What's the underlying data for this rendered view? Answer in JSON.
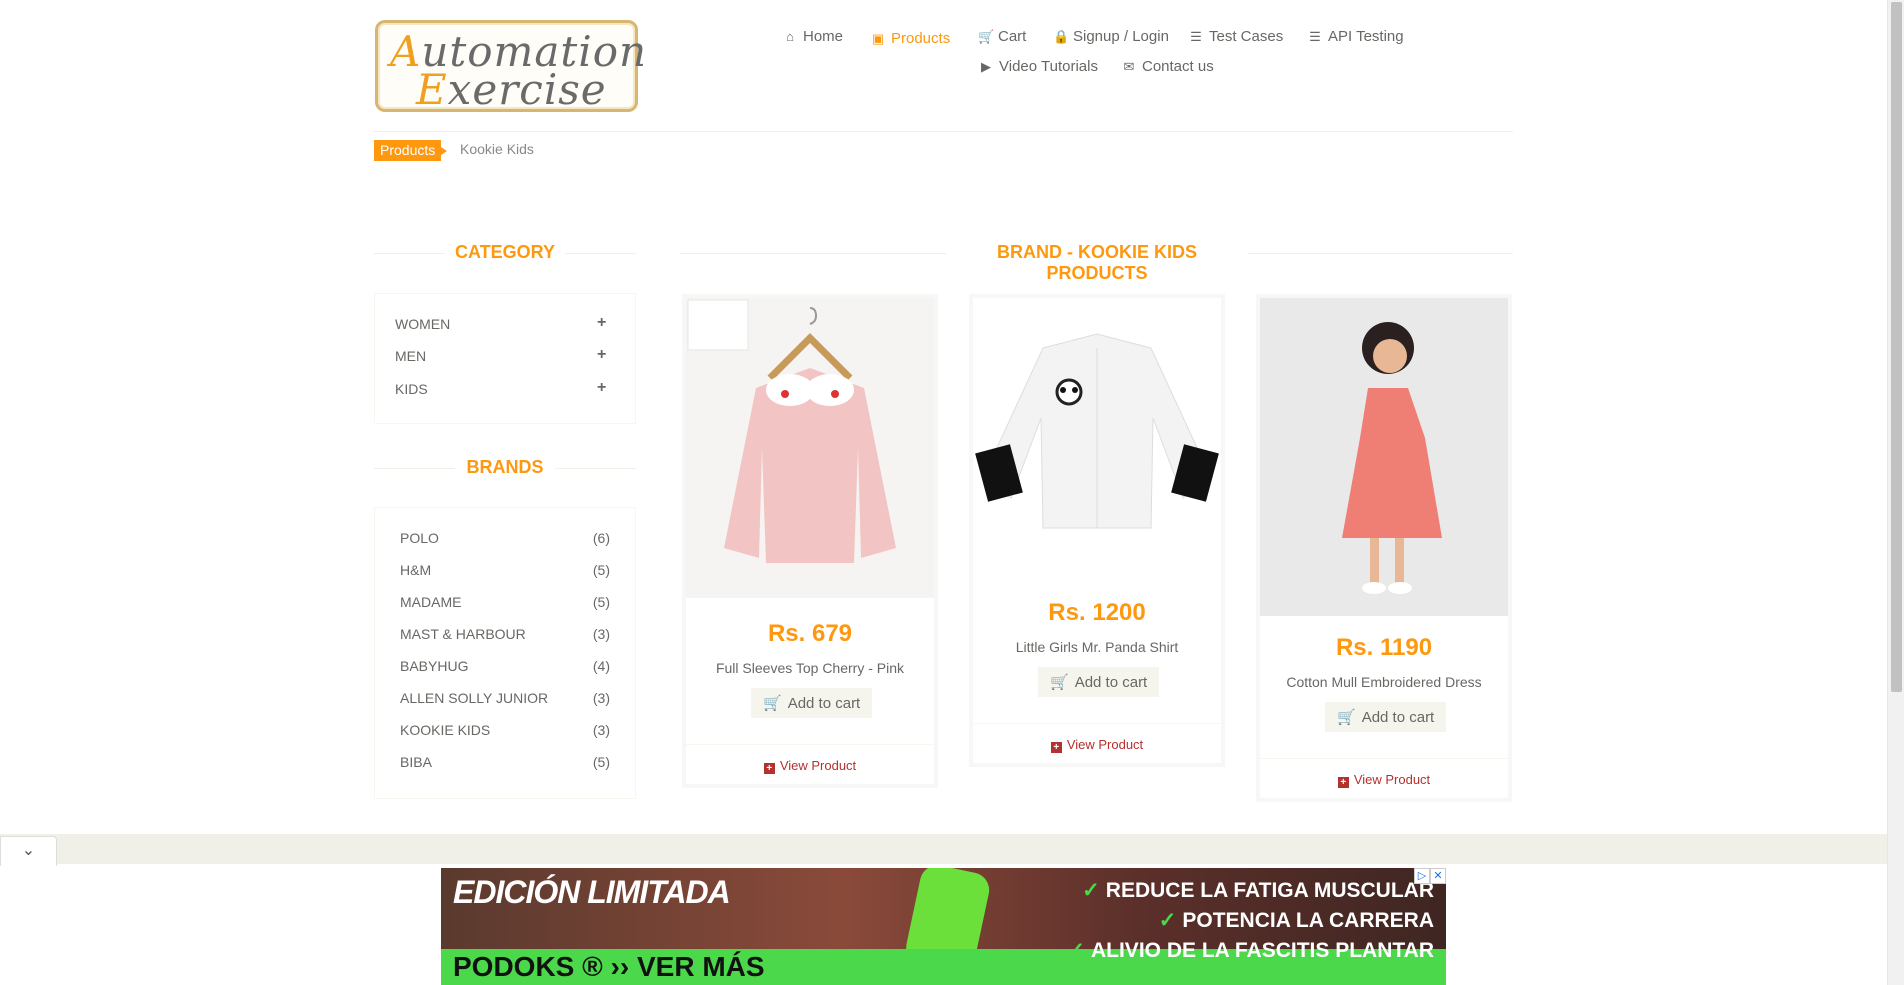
{
  "logo": {
    "line1": "utomation",
    "line1_cap": "A",
    "line2": "xercise",
    "line2_cap": "E"
  },
  "nav": [
    {
      "label": "Home",
      "icon": "home-icon"
    },
    {
      "label": "Products",
      "icon": "products-icon",
      "active": true
    },
    {
      "label": "Cart",
      "icon": "cart-icon"
    },
    {
      "label": "Signup / Login",
      "icon": "lock-icon"
    },
    {
      "label": "Test Cases",
      "icon": "list-icon"
    },
    {
      "label": "API Testing",
      "icon": "list-icon"
    },
    {
      "label": "Video Tutorials",
      "icon": "youtube-icon"
    },
    {
      "label": "Contact us",
      "icon": "envelope-icon"
    }
  ],
  "breadcrumb": {
    "active": "Products",
    "current": "Kookie Kids"
  },
  "sidebar": {
    "category_title": "Category",
    "categories": [
      "Women",
      "Men",
      "Kids"
    ],
    "brands_title": "Brands",
    "brands": [
      {
        "name": "Polo",
        "count": "(6)"
      },
      {
        "name": "H&M",
        "count": "(5)"
      },
      {
        "name": "Madame",
        "count": "(5)"
      },
      {
        "name": "Mast & Harbour",
        "count": "(3)"
      },
      {
        "name": "Babyhug",
        "count": "(4)"
      },
      {
        "name": "Allen Solly Junior",
        "count": "(3)"
      },
      {
        "name": "Kookie Kids",
        "count": "(3)"
      },
      {
        "name": "Biba",
        "count": "(5)"
      }
    ]
  },
  "main": {
    "title": "Brand - Kookie Kids Products",
    "products": [
      {
        "price": "Rs. 679",
        "name": "Full Sleeves Top Cherry - Pink",
        "add_label": "Add to cart",
        "view_label": "View Product",
        "image": "pink-top-image"
      },
      {
        "price": "Rs. 1200",
        "name": "Little Girls Mr. Panda Shirt",
        "add_label": "Add to cart",
        "view_label": "View Product",
        "image": "panda-shirt-image"
      },
      {
        "price": "Rs. 1190",
        "name": "Cotton Mull Embroidered Dress",
        "add_label": "Add to cart",
        "view_label": "View Product",
        "image": "dress-image"
      }
    ]
  },
  "ad": {
    "headline": "EDICIÓN LIMITADA",
    "brand": "PODOKS",
    "cta": "VER MÁS",
    "bullets": [
      "REDUCE LA FATIGA MUSCULAR",
      "POTENCIA LA CARRERA",
      "ALIVIO DE LA FASCITIS PLANTAR"
    ]
  },
  "colors": {
    "accent": "#fe980f",
    "text": "#696763",
    "view_link": "#b4312d"
  }
}
